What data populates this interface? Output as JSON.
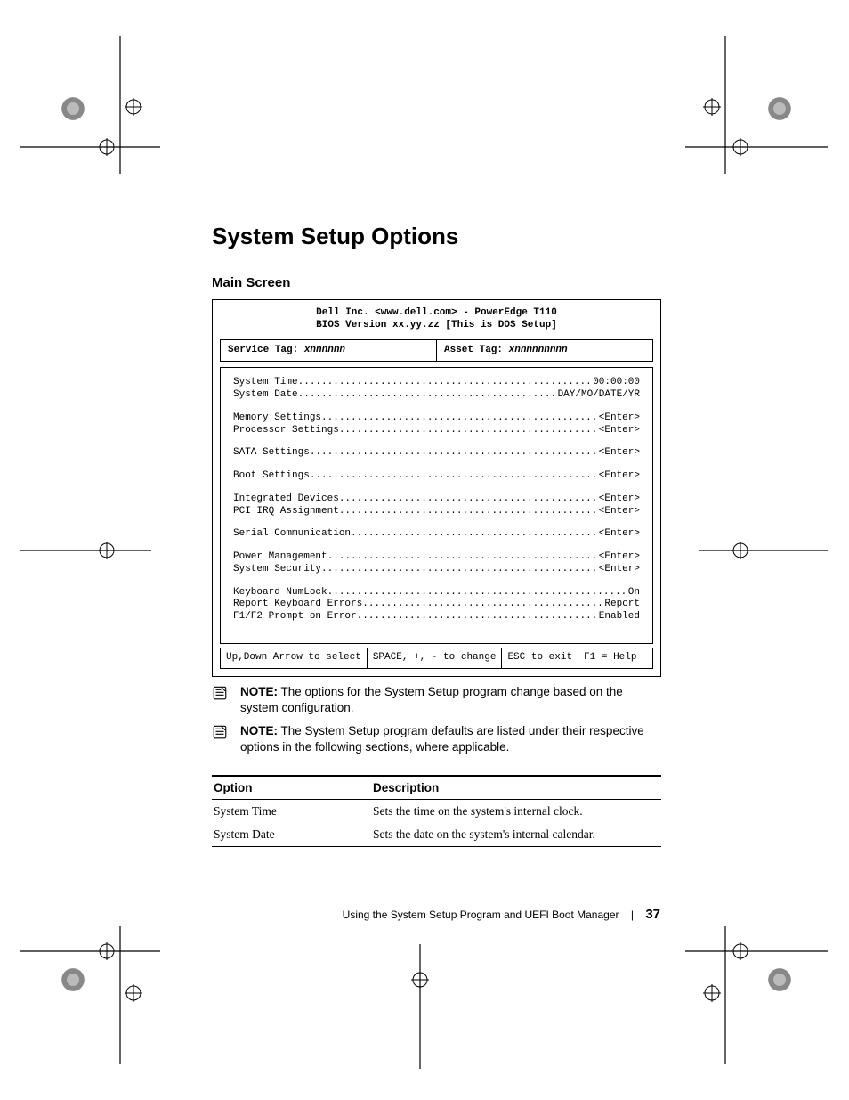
{
  "heading": "System Setup Options",
  "subheading": "Main Screen",
  "bios": {
    "header1": "Dell Inc. <www.dell.com> - PowerEdge T110",
    "header2": "BIOS Version xx.yy.zz [This is DOS Setup]",
    "service_tag_label": "Service Tag:",
    "service_tag_value": "xnnnnnn",
    "asset_tag_label": "Asset Tag:",
    "asset_tag_value": "xnnnnnnnnn",
    "groups": [
      [
        {
          "label": "System Time",
          "value": "00:00:00"
        },
        {
          "label": "System Date",
          "value": "DAY/MO/DATE/YR"
        }
      ],
      [
        {
          "label": "Memory Settings",
          "value": "<Enter>"
        },
        {
          "label": "Processor Settings",
          "value": "<Enter>"
        }
      ],
      [
        {
          "label": "SATA Settings",
          "value": "<Enter>"
        }
      ],
      [
        {
          "label": "Boot Settings",
          "value": "<Enter>"
        }
      ],
      [
        {
          "label": "Integrated Devices",
          "value": "<Enter>"
        },
        {
          "label": "PCI IRQ Assignment",
          "value": "<Enter>"
        }
      ],
      [
        {
          "label": "Serial Communication",
          "value": "<Enter>"
        }
      ],
      [
        {
          "label": "Power Management",
          "value": "<Enter>"
        },
        {
          "label": "System Security",
          "value": "<Enter>"
        }
      ],
      [
        {
          "label": "Keyboard NumLock",
          "value": "On"
        },
        {
          "label": "Report Keyboard Errors",
          "value": "Report"
        },
        {
          "label": "F1/F2 Prompt on Error",
          "value": "Enabled"
        }
      ]
    ],
    "footer": [
      "Up,Down Arrow to select",
      "SPACE, +, - to change",
      "ESC to exit",
      "F1 = Help"
    ]
  },
  "notes": [
    {
      "label": "NOTE:",
      "text": " The options for the System Setup program change based on the system configuration."
    },
    {
      "label": "NOTE:",
      "text": " The System Setup program defaults are listed under their respective options in the following sections, where applicable."
    }
  ],
  "table": {
    "headers": [
      "Option",
      "Description"
    ],
    "rows": [
      [
        "System Time",
        "Sets the time on the system's internal clock."
      ],
      [
        "System Date",
        "Sets the date on the system's internal calendar."
      ]
    ]
  },
  "footer": {
    "text": "Using the System Setup Program and UEFI Boot Manager",
    "page": "37"
  }
}
